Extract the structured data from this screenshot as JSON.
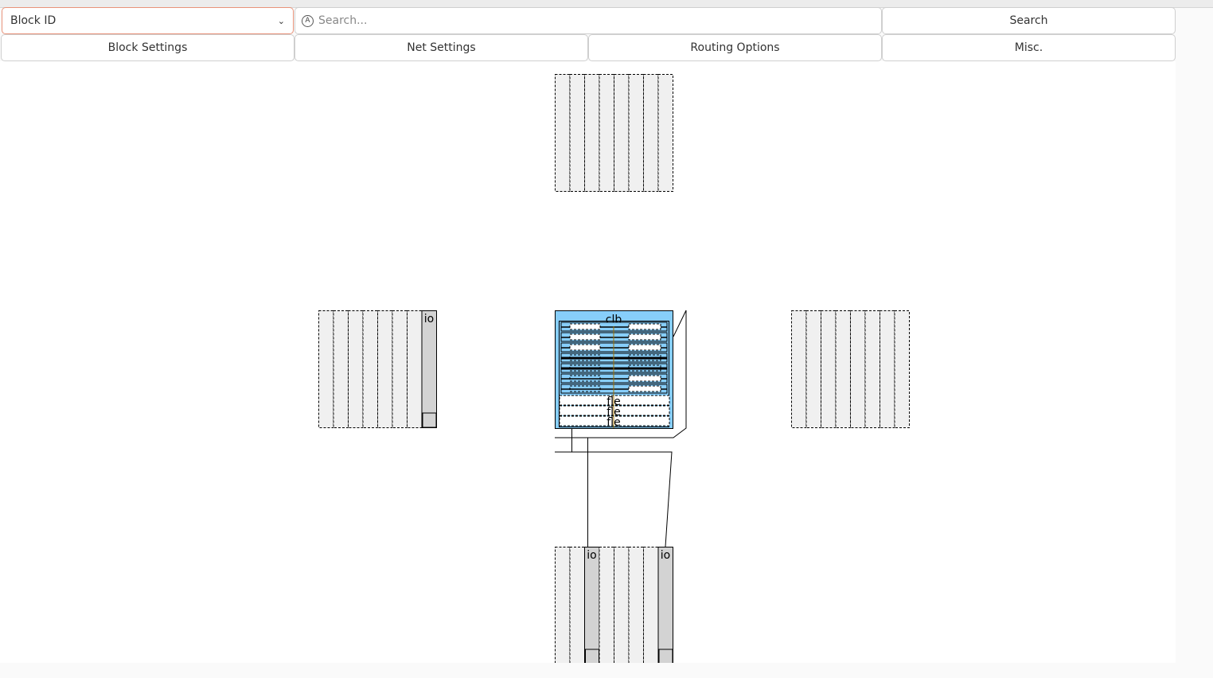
{
  "toolbar": {
    "block_select": "Block ID",
    "search_placeholder": "Search...",
    "search_button": "Search"
  },
  "tabs": [
    {
      "label": "Block Settings"
    },
    {
      "label": "Net Settings"
    },
    {
      "label": "Routing Options"
    },
    {
      "label": "Misc."
    }
  ],
  "canvas": {
    "clb_label": "clb",
    "io_label": "io",
    "fle_labels": [
      "fle",
      "fle",
      "fle"
    ],
    "colors": {
      "clb_fill": "#87cefa",
      "tile_fill": "#f0f0f0",
      "io_fill": "#d3d3d3"
    }
  }
}
